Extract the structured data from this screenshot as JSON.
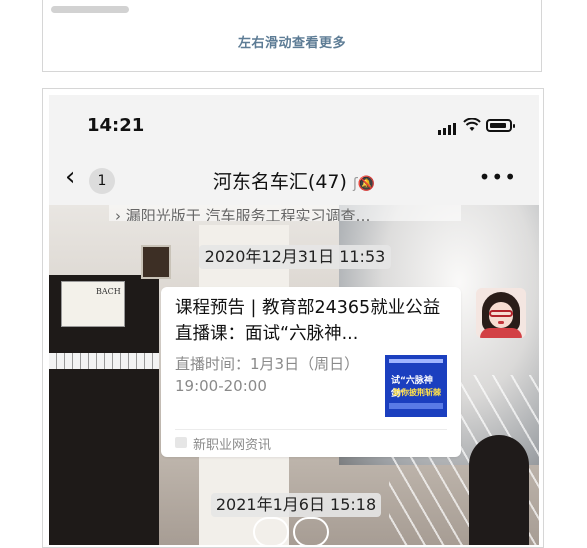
{
  "top_card": {
    "hint": "左右滑动查看更多"
  },
  "status_bar": {
    "time": "14:21"
  },
  "nav": {
    "unread_count": "1",
    "group_name": "河东名车汇(47)"
  },
  "chat": {
    "previous_message_fragment": "› 漏阳光版于  汽车服务工程实习调查…",
    "timestamp_1": "2020年12月31日 11:53",
    "timestamp_2": "2021年1月6日 15:18",
    "card": {
      "title": "课程预告 | 教育部24365就业公益直播课：面试“六脉神...",
      "description": "直播时间：1月3日（周日）19:00-20:00",
      "thumbnail_title": "试“六脉神剑”",
      "thumbnail_subtitle": "助你披荆斩棘",
      "source": "新职业网资讯"
    }
  },
  "photo": {
    "sheet_label": "BACH"
  }
}
